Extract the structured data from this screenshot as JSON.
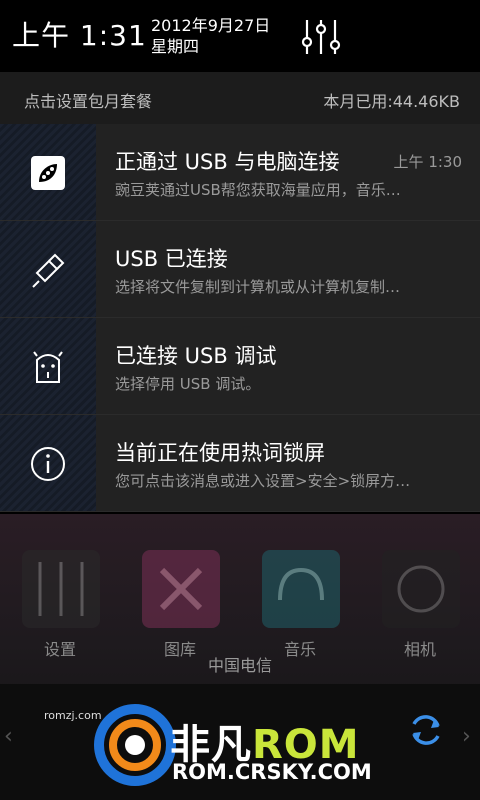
{
  "header": {
    "time": "上午 1:31",
    "date": "2012年9月27日",
    "weekday": "星期四",
    "settings_icon": "sliders-icon"
  },
  "usage": {
    "left": "点击设置包月套餐",
    "right": "本月已用:44.46KB"
  },
  "notifications": [
    {
      "icon": "wandoujia-icon",
      "title": "正通过 USB 与电脑连接",
      "text": "豌豆荚通过USB帮您获取海量应用，音乐…",
      "time": "上午 1:30"
    },
    {
      "icon": "usb-icon",
      "title": "USB 已连接",
      "text": "选择将文件复制到计算机或从计算机复制…",
      "time": ""
    },
    {
      "icon": "android-debug-icon",
      "title": "已连接 USB 调试",
      "text": "选择停用 USB 调试。",
      "time": ""
    },
    {
      "icon": "info-icon",
      "title": "当前正在使用热词锁屏",
      "text": "您可点击该消息或进入设置>安全>锁屏方…",
      "time": ""
    }
  ],
  "home": {
    "apps": [
      "设置",
      "图库",
      "音乐",
      "相机"
    ],
    "carrier": "中国电信"
  },
  "watermark": {
    "small": "romzj.com",
    "brand_a": "非凡",
    "brand_b": "ROM",
    "url": "ROM.CRSKY.COM"
  },
  "colors": {
    "accent": "#c9e53a",
    "sync": "#3b8fe8"
  }
}
